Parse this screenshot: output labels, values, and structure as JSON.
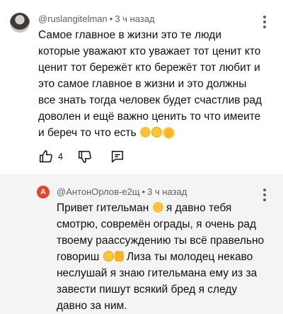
{
  "comments": [
    {
      "author": "@ruslangitelman",
      "time": "3 ч назад",
      "text": "Самое главное в жизни это те люди которые уважают кто уважает тот ценит кто ценит тот бережёт кто бережёт тот любит и это самое главное в жизни и это должны все знать тогда человек будет счастлив рад доволен и ещё важно ценить то что имеите и береч то что есть",
      "emojis": [
        "hugging-face-emoji",
        "smiling-face-emoji",
        "sun-emoji"
      ],
      "likes": "4"
    },
    {
      "author": "@АнтонОрлов-е2щ",
      "avatar_letter": "А",
      "time": "3 ч назад",
      "text_1": "Привет гительман",
      "text_2": "я давно тебя смотрю, совремён ограды, я очень рад твоему раассуждению ты всё правельно говориш",
      "text_3": "Лиза ты молодец некаво неслушай я знаю гительмана ему из за завести пишут всякий бред я следу давно за ним.",
      "emojis": [
        "hugging-face-emoji",
        "smiling-face-emoji",
        "thumbs-up-emoji"
      ]
    }
  ],
  "separator": "•",
  "colors": {
    "meta": "#606060",
    "text": "#0f0f0f",
    "reply_bg": "#f4f4f4",
    "avatar_bg": "#e8432f"
  }
}
